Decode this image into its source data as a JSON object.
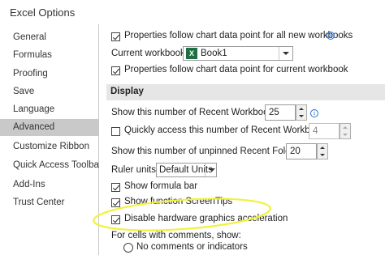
{
  "window": {
    "title": "Excel Options"
  },
  "sidebar": {
    "items": [
      {
        "label": "General"
      },
      {
        "label": "Formulas"
      },
      {
        "label": "Proofing"
      },
      {
        "label": "Save"
      },
      {
        "label": "Language"
      },
      {
        "label": "Advanced",
        "selected": true
      },
      {
        "label": "Customize Ribbon"
      },
      {
        "label": "Quick Access Toolbar"
      },
      {
        "label": "Add-Ins"
      },
      {
        "label": "Trust Center"
      }
    ]
  },
  "charts": {
    "follow_all_label": "Properties follow chart data point for all new workbooks",
    "follow_all_checked": true,
    "current_workbook_label": "Current workbook:",
    "current_workbook_value": "Book1",
    "follow_current_label": "Properties follow chart data point for current workbook",
    "follow_current_checked": true
  },
  "display": {
    "section_title": "Display",
    "recent_workbooks_label": "Show this number of Recent Workbooks:",
    "recent_workbooks_value": "25",
    "quick_access_label": "Quickly access this number of Recent Workbooks:",
    "quick_access_checked": false,
    "quick_access_value": "4",
    "unpinned_folders_label": "Show this number of unpinned Recent Folders:",
    "unpinned_folders_value": "20",
    "ruler_units_label": "Ruler units",
    "ruler_units_value": "Default Units",
    "formula_bar_label": "Show formula bar",
    "formula_bar_checked": true,
    "function_tips_label": "Show function ScreenTips",
    "function_tips_checked": true,
    "disable_hw_label": "Disable hardware graphics acceleration",
    "disable_hw_checked": true,
    "comments_label": "For cells with comments, show:",
    "no_comments_label": "No comments or indicators"
  },
  "colors": {
    "highlight": "#f2f23a",
    "selected_nav": "#c9c9c9",
    "excel_green": "#1d7044",
    "info_blue": "#2a6fcf"
  },
  "icons": {
    "info": "i",
    "excel": "X"
  }
}
